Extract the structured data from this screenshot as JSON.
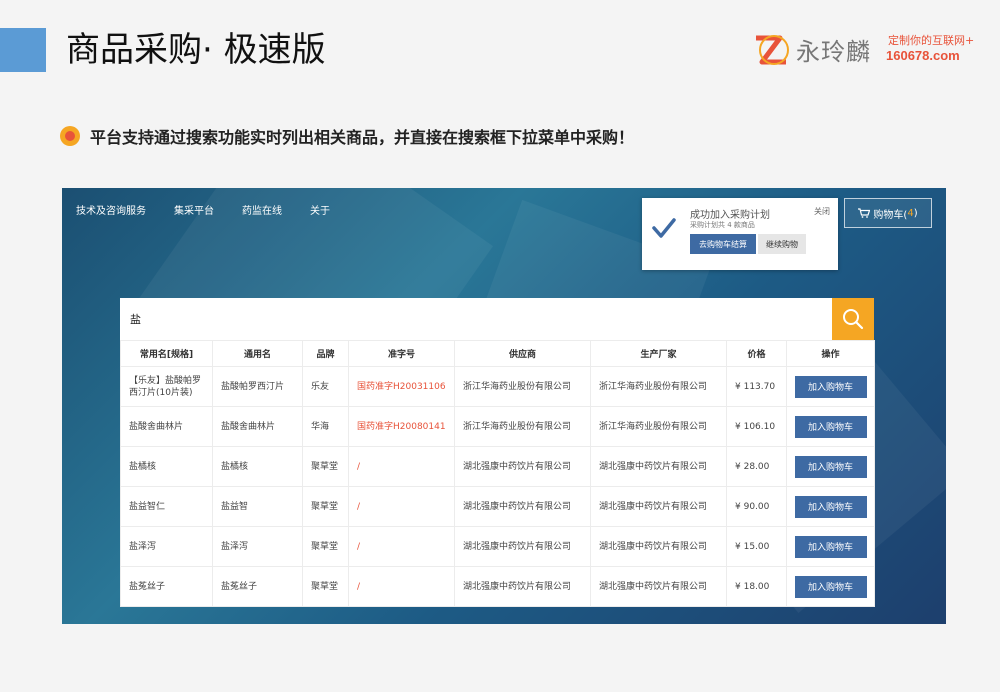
{
  "page": {
    "title": "商品采购· 极速版",
    "headline": "平台支持通过搜索功能实时列出相关商品，并直接在搜索框下拉菜单中采购！"
  },
  "logo": {
    "name": "永玲麟",
    "slogan": "定制你的互联网+",
    "domain": "160678.com"
  },
  "app": {
    "nav": [
      "技术及咨询服务",
      "集采平台",
      "药监在线",
      "关于"
    ],
    "popup": {
      "title": "成功加入采购计划",
      "subtitle": "采购计划共 4 款商品",
      "close": "关闭",
      "checkout": "去购物车结算",
      "continue": "继续购物"
    },
    "cart": {
      "label": "购物车(",
      "count": "4",
      "suffix": ")"
    },
    "search": {
      "value": "盐"
    },
    "table": {
      "headers": [
        "常用名[规格]",
        "通用名",
        "品牌",
        "准字号",
        "供应商",
        "生产厂家",
        "价格",
        "操作"
      ],
      "action_label": "加入购物车",
      "rows": [
        {
          "common": "【乐友】盐酸帕罗西汀片(10片装)",
          "generic": "盐酸帕罗西汀片",
          "brand": "乐友",
          "approval": "国药准字H20031106",
          "supplier": "浙江华海药业股份有限公司",
          "maker": "浙江华海药业股份有限公司",
          "price": "¥ 113.70"
        },
        {
          "common": "盐酸舍曲林片",
          "generic": "盐酸舍曲林片",
          "brand": "华海",
          "approval": "国药准字H20080141",
          "supplier": "浙江华海药业股份有限公司",
          "maker": "浙江华海药业股份有限公司",
          "price": "¥ 106.10"
        },
        {
          "common": "盐橘核",
          "generic": "盐橘核",
          "brand": "聚草堂",
          "approval": "/",
          "supplier": "湖北强康中药饮片有限公司",
          "maker": "湖北强康中药饮片有限公司",
          "price": "¥ 28.00"
        },
        {
          "common": "盐益智仁",
          "generic": "盐益智",
          "brand": "聚草堂",
          "approval": "/",
          "supplier": "湖北强康中药饮片有限公司",
          "maker": "湖北强康中药饮片有限公司",
          "price": "¥ 90.00"
        },
        {
          "common": "盐泽泻",
          "generic": "盐泽泻",
          "brand": "聚草堂",
          "approval": "/",
          "supplier": "湖北强康中药饮片有限公司",
          "maker": "湖北强康中药饮片有限公司",
          "price": "¥ 15.00"
        },
        {
          "common": "盐菟丝子",
          "generic": "盐菟丝子",
          "brand": "聚草堂",
          "approval": "/",
          "supplier": "湖北强康中药饮片有限公司",
          "maker": "湖北强康中药饮片有限公司",
          "price": "¥ 18.00"
        }
      ]
    }
  },
  "colors": {
    "accent": "#f5a623",
    "button": "#3e6aa3",
    "title_bar": "#5b9bd5",
    "approval_text": "#e8533a"
  }
}
